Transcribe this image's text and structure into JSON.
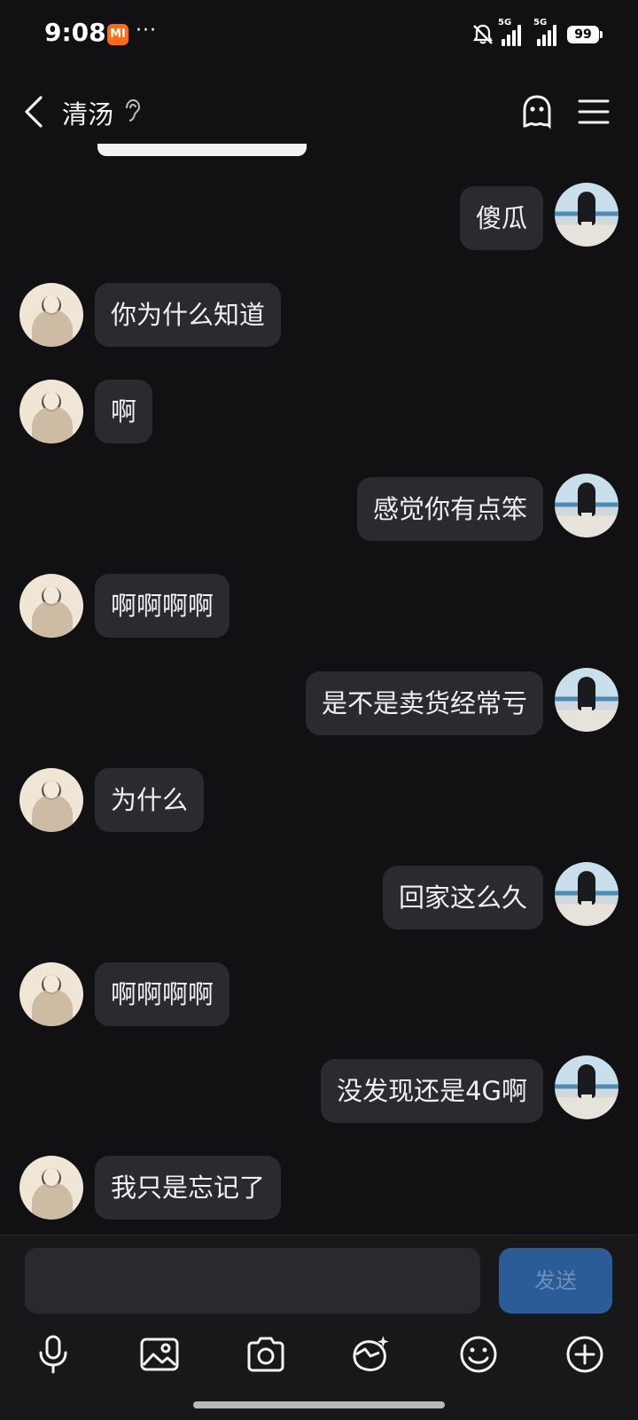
{
  "status_bar": {
    "time": "9:08",
    "mi_badge": "MI",
    "dots": "···",
    "net1": "5G",
    "net2": "5G",
    "battery": "99"
  },
  "header": {
    "title": "清汤"
  },
  "messages": [
    {
      "side": "right",
      "text": "傻瓜"
    },
    {
      "side": "left",
      "text": "你为什么知道"
    },
    {
      "side": "left",
      "text": "啊"
    },
    {
      "side": "right",
      "text": "感觉你有点笨"
    },
    {
      "side": "left",
      "text": "啊啊啊啊"
    },
    {
      "side": "right",
      "text": "是不是卖货经常亏"
    },
    {
      "side": "left",
      "text": "为什么"
    },
    {
      "side": "right",
      "text": "回家这么久"
    },
    {
      "side": "left",
      "text": "啊啊啊啊"
    },
    {
      "side": "right",
      "text": "没发现还是4G啊"
    },
    {
      "side": "left",
      "text": "我只是忘记了"
    }
  ],
  "input": {
    "placeholder": "",
    "send_label": "发送"
  },
  "toolbar_icons": [
    "microphone-icon",
    "image-icon",
    "camera-icon",
    "sticker-icon",
    "emoji-icon",
    "plus-icon"
  ],
  "colors": {
    "background": "#111113",
    "bubble": "#2b2b2f",
    "send_button": "#2b5c97"
  }
}
